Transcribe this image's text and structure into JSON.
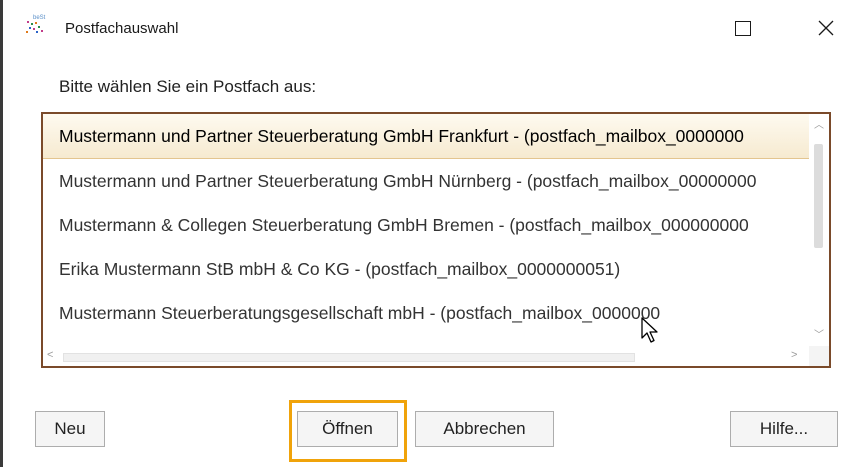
{
  "window": {
    "title": "Postfachauswahl",
    "icon": "beSt-app-icon",
    "icon_text": "beSt",
    "maximize_icon": "maximize-icon",
    "close_icon": "close-icon"
  },
  "prompt": "Bitte wählen Sie ein Postfach aus:",
  "mailboxes": [
    "Mustermann und Partner Steuerberatung GmbH Frankfurt - (postfach_mailbox_0000000",
    "Mustermann und Partner Steuerberatung GmbH Nürnberg - (postfach_mailbox_00000000",
    "Mustermann & Collegen Steuerberatung GmbH Bremen - (postfach_mailbox_000000000",
    "Erika Mustermann StB mbH & Co KG - (postfach_mailbox_0000000051)",
    "Mustermann Steuerberatungsgesellschaft mbH - (postfach_mailbox_0000000"
  ],
  "selected_index": 0,
  "buttons": {
    "new": "Neu",
    "open": "Öffnen",
    "cancel": "Abbrechen",
    "help": "Hilfe..."
  },
  "colors": {
    "focus_ring": "#f0a30a",
    "list_border": "#7a4a2a",
    "selection": "#f6ead0"
  }
}
